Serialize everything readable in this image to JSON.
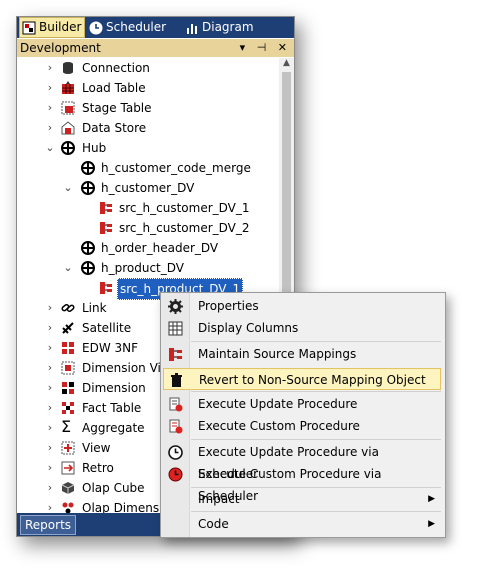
{
  "tabs": [
    {
      "label": "Builder",
      "icon": "builder-icon"
    },
    {
      "label": "Scheduler",
      "icon": "clock-icon"
    },
    {
      "label": "Diagram",
      "icon": "bar-chart-icon"
    }
  ],
  "panel": {
    "title": "Development",
    "controls": "▾ ⊣ ✕"
  },
  "tree": [
    {
      "label": "Connection",
      "arrow": "›",
      "icon": "connection-icon"
    },
    {
      "label": "Load Table",
      "arrow": "›",
      "icon": "load-table-icon"
    },
    {
      "label": "Stage Table",
      "arrow": "›",
      "icon": "stage-table-icon"
    },
    {
      "label": "Data Store",
      "arrow": "›",
      "icon": "data-store-icon"
    },
    {
      "label": "Hub",
      "arrow": "⌄",
      "icon": "hub-icon"
    },
    {
      "label": "h_customer_code_merge",
      "arrow": "",
      "icon": "hub-icon"
    },
    {
      "label": "h_customer_DV",
      "arrow": "⌄",
      "icon": "hub-icon"
    },
    {
      "label": "src_h_customer_DV_1",
      "arrow": "",
      "icon": "source-mapping-icon"
    },
    {
      "label": "src_h_customer_DV_2",
      "arrow": "",
      "icon": "source-mapping-icon"
    },
    {
      "label": "h_order_header_DV",
      "arrow": "",
      "icon": "hub-icon"
    },
    {
      "label": "h_product_DV",
      "arrow": "⌄",
      "icon": "hub-icon"
    },
    {
      "label": "src_h_product_DV_1",
      "arrow": "",
      "icon": "source-mapping-icon"
    },
    {
      "label": "Link",
      "arrow": "›",
      "icon": "link-icon"
    },
    {
      "label": "Satellite",
      "arrow": "›",
      "icon": "satellite-icon"
    },
    {
      "label": "EDW 3NF",
      "arrow": "›",
      "icon": "edw-icon"
    },
    {
      "label": "Dimension View",
      "arrow": "›",
      "icon": "dimension-view-icon"
    },
    {
      "label": "Dimension",
      "arrow": "›",
      "icon": "dimension-icon"
    },
    {
      "label": "Fact Table",
      "arrow": "›",
      "icon": "fact-table-icon"
    },
    {
      "label": "Aggregate",
      "arrow": "›",
      "icon": "sigma-icon"
    },
    {
      "label": "View",
      "arrow": "›",
      "icon": "view-icon"
    },
    {
      "label": "Retro",
      "arrow": "›",
      "icon": "retro-icon"
    },
    {
      "label": "Olap Cube",
      "arrow": "›",
      "icon": "olap-cube-icon"
    },
    {
      "label": "Olap Dimension",
      "arrow": "›",
      "icon": "olap-dimension-icon"
    }
  ],
  "bottom": {
    "reports_label": "Reports"
  },
  "context_menu": [
    {
      "label": "Properties",
      "icon": "gear-icon",
      "submenu": false
    },
    {
      "label": "Display Columns",
      "icon": "grid-icon",
      "submenu": false
    },
    {
      "label": "Maintain Source Mappings",
      "icon": "source-mapping-icon",
      "submenu": false
    },
    {
      "label": "Revert to Non-Source Mapping Object",
      "icon": "trash-icon",
      "submenu": false
    },
    {
      "label": "Execute Update Procedure",
      "icon": "procedure-icon",
      "submenu": false
    },
    {
      "label": "Execute Custom Procedure",
      "icon": "custom-procedure-icon",
      "submenu": false
    },
    {
      "label": "Execute Update Procedure via Scheduler",
      "icon": "clock-icon",
      "submenu": false
    },
    {
      "label": "Execute Custom Procedure via Scheduler",
      "icon": "red-clock-icon",
      "submenu": false
    },
    {
      "label": "Impact",
      "icon": "",
      "submenu": true
    },
    {
      "label": "Code",
      "icon": "",
      "submenu": true
    }
  ],
  "colors": {
    "tab_bar": "#1e3f76",
    "active_tab": "#f7e9a6",
    "selection": "#1f5fbf",
    "highlight": "#fdf4bf"
  }
}
